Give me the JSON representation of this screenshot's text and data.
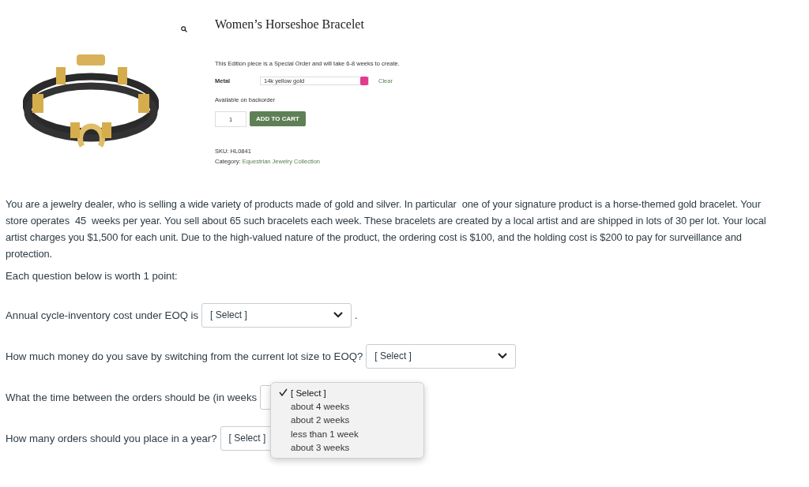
{
  "product": {
    "title": "Women’s Horseshoe Bracelet",
    "note": "This Edition piece is a Special Order and will take 6-8 weeks to create.",
    "option_label": "Metal",
    "option_value": "14k yellow gold",
    "clear": "Clear",
    "availability": "Available on backorder",
    "quantity": "1",
    "add_to_cart": "ADD TO CART",
    "sku": "SKU: HL0841",
    "category_label": "Category:",
    "category_link": "Equestrian Jewelry Collection"
  },
  "intro": "You are a jewelry dealer, who is selling a wide variety of products made of gold and silver. In particular  one of your signature product is a horse-themed gold bracelet. Your store operates  45  weeks per year. You sell about 65 such bracelets each week. These bracelets are created by a local artist and are shipped in lots of 30 per lot. Your local artist charges you $1,500 for each unit. Due to the high-valued nature of the product, the ordering cost is $100, and the holding cost is $200 to pay for surveillance and protection.",
  "points_note": "Each question below is worth 1 point:",
  "questions": [
    {
      "prompt": "Annual cycle-inventory cost under EOQ is",
      "value": "[ Select ]",
      "after": ".",
      "open": false
    },
    {
      "prompt": "How much money do you save by switching from the current lot size to EOQ?",
      "value": "[ Select ]",
      "open": false
    },
    {
      "prompt": "What the time between the orders should be (in weeks",
      "open": true,
      "options": [
        {
          "label": "[ Select ]",
          "selected": true
        },
        {
          "label": "about 4 weeks",
          "selected": false
        },
        {
          "label": "about 2 weeks",
          "selected": false
        },
        {
          "label": "less than 1 week",
          "selected": false
        },
        {
          "label": "about 3 weeks",
          "selected": false
        }
      ]
    },
    {
      "prompt": "How many orders should you place in a year?",
      "value": "[ Select ]",
      "open": false
    }
  ]
}
